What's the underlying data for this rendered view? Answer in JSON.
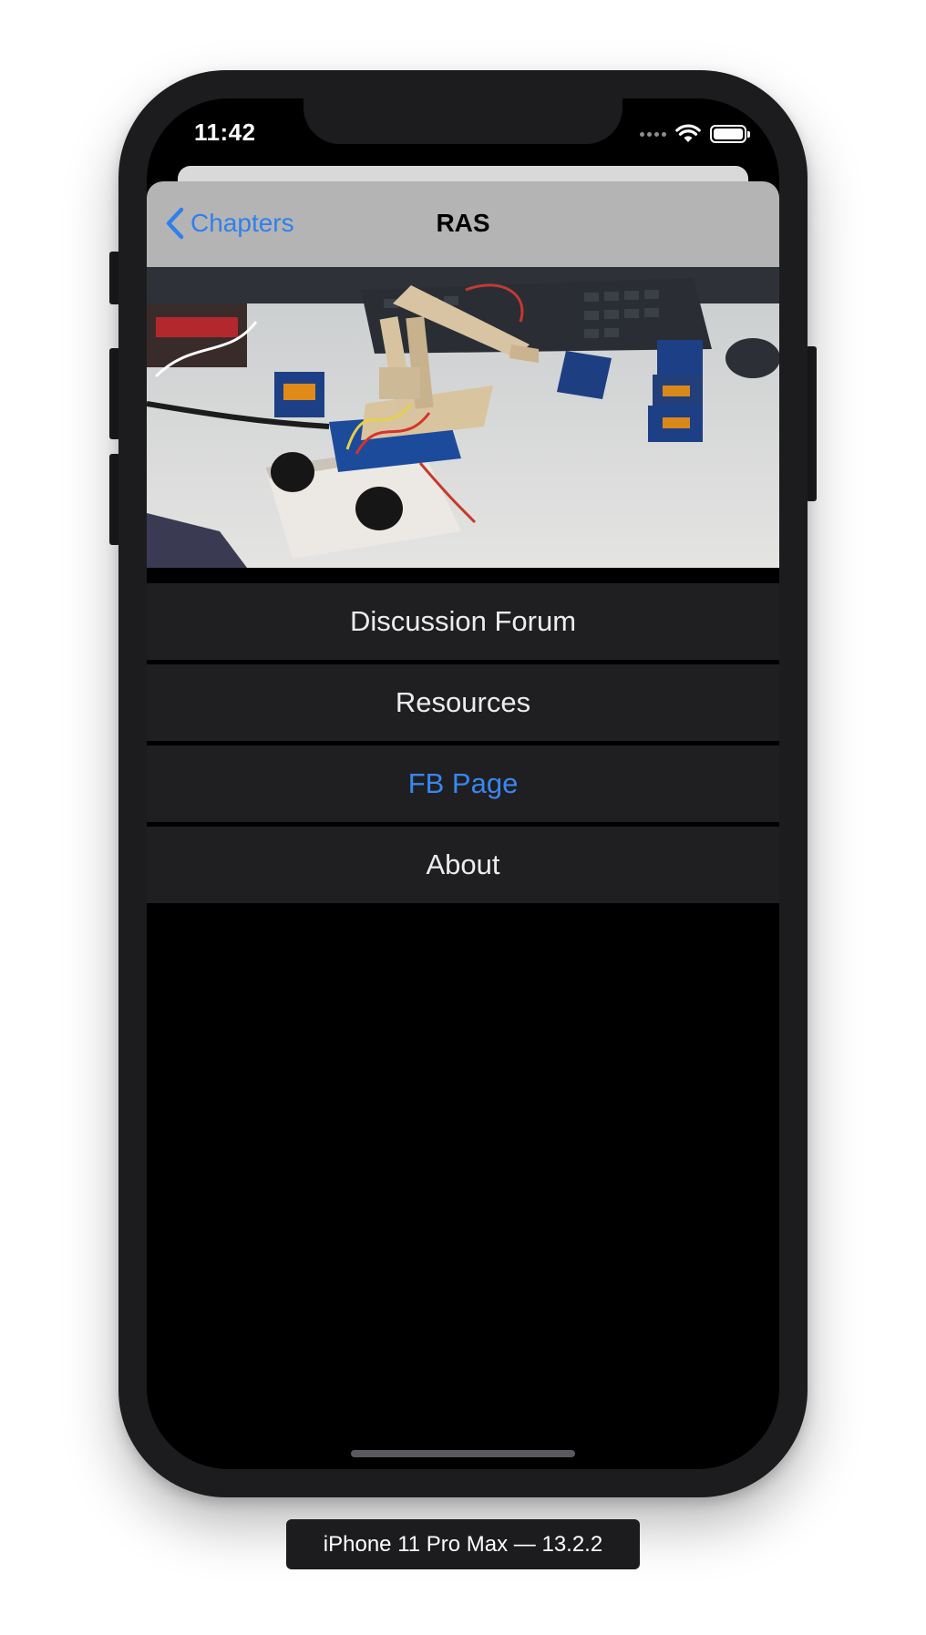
{
  "status_bar": {
    "time": "11:42"
  },
  "nav": {
    "back_label": "Chapters",
    "title": "RAS"
  },
  "hero_image": {
    "icon": "robot-arm-photo"
  },
  "menu": {
    "items": [
      {
        "label": "Discussion Forum"
      },
      {
        "label": "Resources"
      },
      {
        "label": "FB Page"
      },
      {
        "label": "About"
      }
    ]
  },
  "device_label": "iPhone 11 Pro Max — 13.2.2",
  "colors": {
    "accent": "#2f80ed",
    "navbar": "#b4b4b4",
    "cell": "#1f1f21",
    "background": "#000000"
  }
}
